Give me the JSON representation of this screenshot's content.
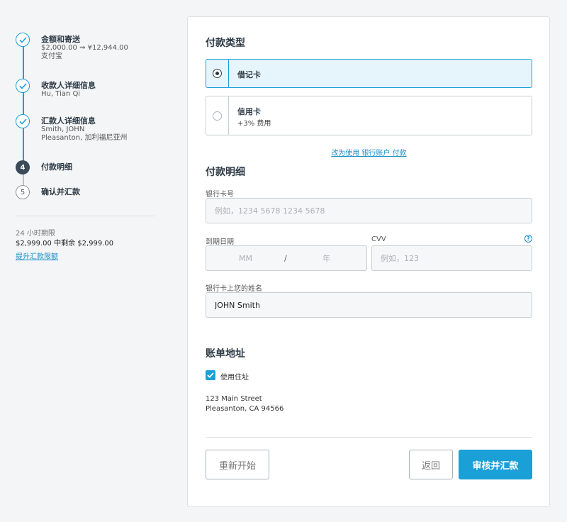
{
  "steps": [
    {
      "title": "金额和寄送",
      "lines": [
        "$2,000.00 ⇒ ¥12,944.00",
        "支付宝"
      ],
      "status": "done"
    },
    {
      "title": "收款人详细信息",
      "lines": [
        "Hu, Tian Qi"
      ],
      "status": "done"
    },
    {
      "title": "汇款人详细信息",
      "lines": [
        "Smith, JOHN",
        "Pleasanton, 加利福尼亚州"
      ],
      "status": "done"
    },
    {
      "title": "付款明细",
      "number": "4",
      "status": "current"
    },
    {
      "title": "确认并汇款",
      "number": "5",
      "status": "todo"
    }
  ],
  "limit": {
    "period": "24 小时期限",
    "remaining": "$2,999.00 中剩余 $2,999.00",
    "raise_link": "提升汇款限额"
  },
  "payment_type": {
    "heading": "付款类型",
    "options": [
      {
        "label": "借记卡",
        "selected": true
      },
      {
        "label": "信用卡",
        "sub": "+3% 费用",
        "selected": false
      }
    ],
    "switch_link": "改为使用 银行账户 付款"
  },
  "payment_details": {
    "heading": "付款明细",
    "card_number_label": "银行卡号",
    "card_number_placeholder": "例如，1234 5678 1234 5678",
    "expiry_label": "到期日期",
    "expiry_month_placeholder": "MM",
    "expiry_separator": "/",
    "expiry_year_placeholder": "年",
    "cvv_label": "CVV",
    "cvv_placeholder": "例如，123",
    "help_glyph": "?",
    "name_label": "银行卡上您的姓名",
    "name_value": "JOHN Smith"
  },
  "billing": {
    "heading": "账单地址",
    "use_residential_label": "使用住址",
    "use_residential_checked": true,
    "address_line1": "123 Main Street",
    "address_line2": "Pleasanton, CA  94566"
  },
  "actions": {
    "restart": "重新开始",
    "back": "返回",
    "review_send": "审核并汇款"
  },
  "colors": {
    "accent": "#1aa0d6",
    "current_step": "#3a4a59",
    "link": "#1a8fc9"
  }
}
